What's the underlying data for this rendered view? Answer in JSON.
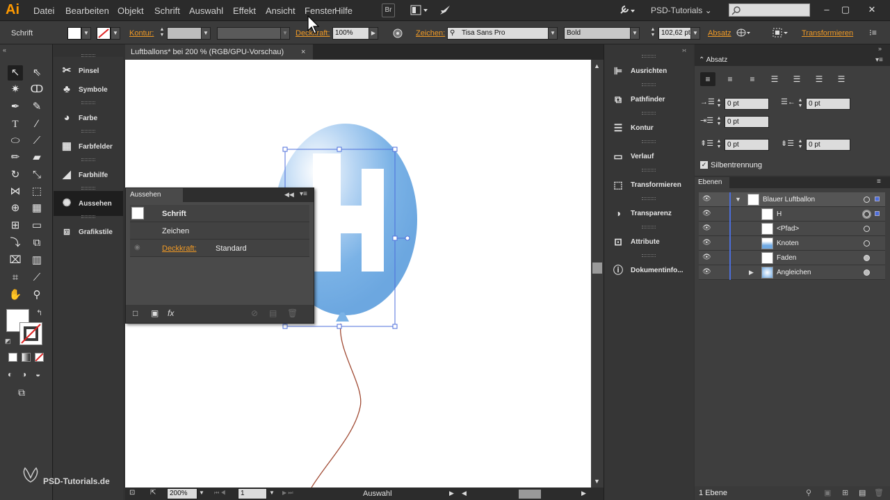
{
  "app": {
    "logo": "Ai",
    "workspace": "PSD-Tutorials"
  },
  "menu": [
    "Datei",
    "Bearbeiten",
    "Objekt",
    "Schrift",
    "Auswahl",
    "Effekt",
    "Ansicht",
    "Fenster",
    "Hilfe"
  ],
  "menu_br": "Br",
  "control": {
    "object_type": "Schrift",
    "kontur_label": "Kontur:",
    "deckkraft_label": "Deckkraft:",
    "deckkraft_value": "100%",
    "zeichen_label": "Zeichen:",
    "font_name": "Tisa Sans Pro",
    "font_style": "Bold",
    "font_size": "102,62 pt",
    "absatz_label": "Absatz",
    "transform_label": "Transformieren"
  },
  "document": {
    "tab": "Luftballons* bei 200 % (RGB/GPU-Vorschau)",
    "tab_close": "×",
    "letter": "H"
  },
  "status": {
    "zoom": "200%",
    "artboard": "1",
    "tool": "Auswahl"
  },
  "left_dock": [
    {
      "label": "Pinsel",
      "icon": "brush-icon"
    },
    {
      "label": "Symbole",
      "icon": "symbols-icon"
    },
    {
      "label": "Farbe",
      "icon": "palette-icon"
    },
    {
      "label": "Farbfelder",
      "icon": "grid-icon"
    },
    {
      "label": "Farbhilfe",
      "icon": "color-guide-icon"
    },
    {
      "label": "Aussehen",
      "icon": "appearance-icon"
    },
    {
      "label": "Grafikstile",
      "icon": "graphic-styles-icon"
    }
  ],
  "aussehen": {
    "title": "Aussehen",
    "rows": [
      {
        "label": "Schrift",
        "value": ""
      },
      {
        "label": "Zeichen",
        "value": ""
      },
      {
        "label": "Deckkraft:",
        "value": "Standard"
      }
    ],
    "fx": "fx"
  },
  "right_dock": [
    {
      "label": "Ausrichten",
      "icon": "align-icon"
    },
    {
      "label": "Pathfinder",
      "icon": "pathfinder-icon"
    },
    {
      "label": "Kontur",
      "icon": "stroke-icon"
    },
    {
      "label": "Verlauf",
      "icon": "gradient-icon"
    },
    {
      "label": "Transformieren",
      "icon": "transform-icon"
    },
    {
      "label": "Transparenz",
      "icon": "transparency-icon"
    },
    {
      "label": "Attribute",
      "icon": "attributes-icon"
    },
    {
      "label": "Dokumentinfo...",
      "icon": "document-info-icon"
    }
  ],
  "absatz": {
    "title": "Absatz",
    "indent_left": "0 pt",
    "indent_right": "0 pt",
    "first_line": "0 pt",
    "space_before": "0 pt",
    "space_after": "0 pt",
    "hyphenation": "Silbentrennung"
  },
  "ebenen": {
    "title": "Ebenen",
    "layers": [
      {
        "name": "Blauer Luftballon",
        "level": 0
      },
      {
        "name": "H",
        "level": 1
      },
      {
        "name": "<Pfad>",
        "level": 1
      },
      {
        "name": "Knoten",
        "level": 1
      },
      {
        "name": "Faden",
        "level": 1
      },
      {
        "name": "Angleichen",
        "level": 1
      }
    ],
    "footer": "1 Ebene"
  },
  "watermark": "PSD-Tutorials.de",
  "colors": {
    "accent": "#f29b25",
    "balloon": "#6fa9e3",
    "string": "#a04a33",
    "selection": "#4c6edb"
  }
}
